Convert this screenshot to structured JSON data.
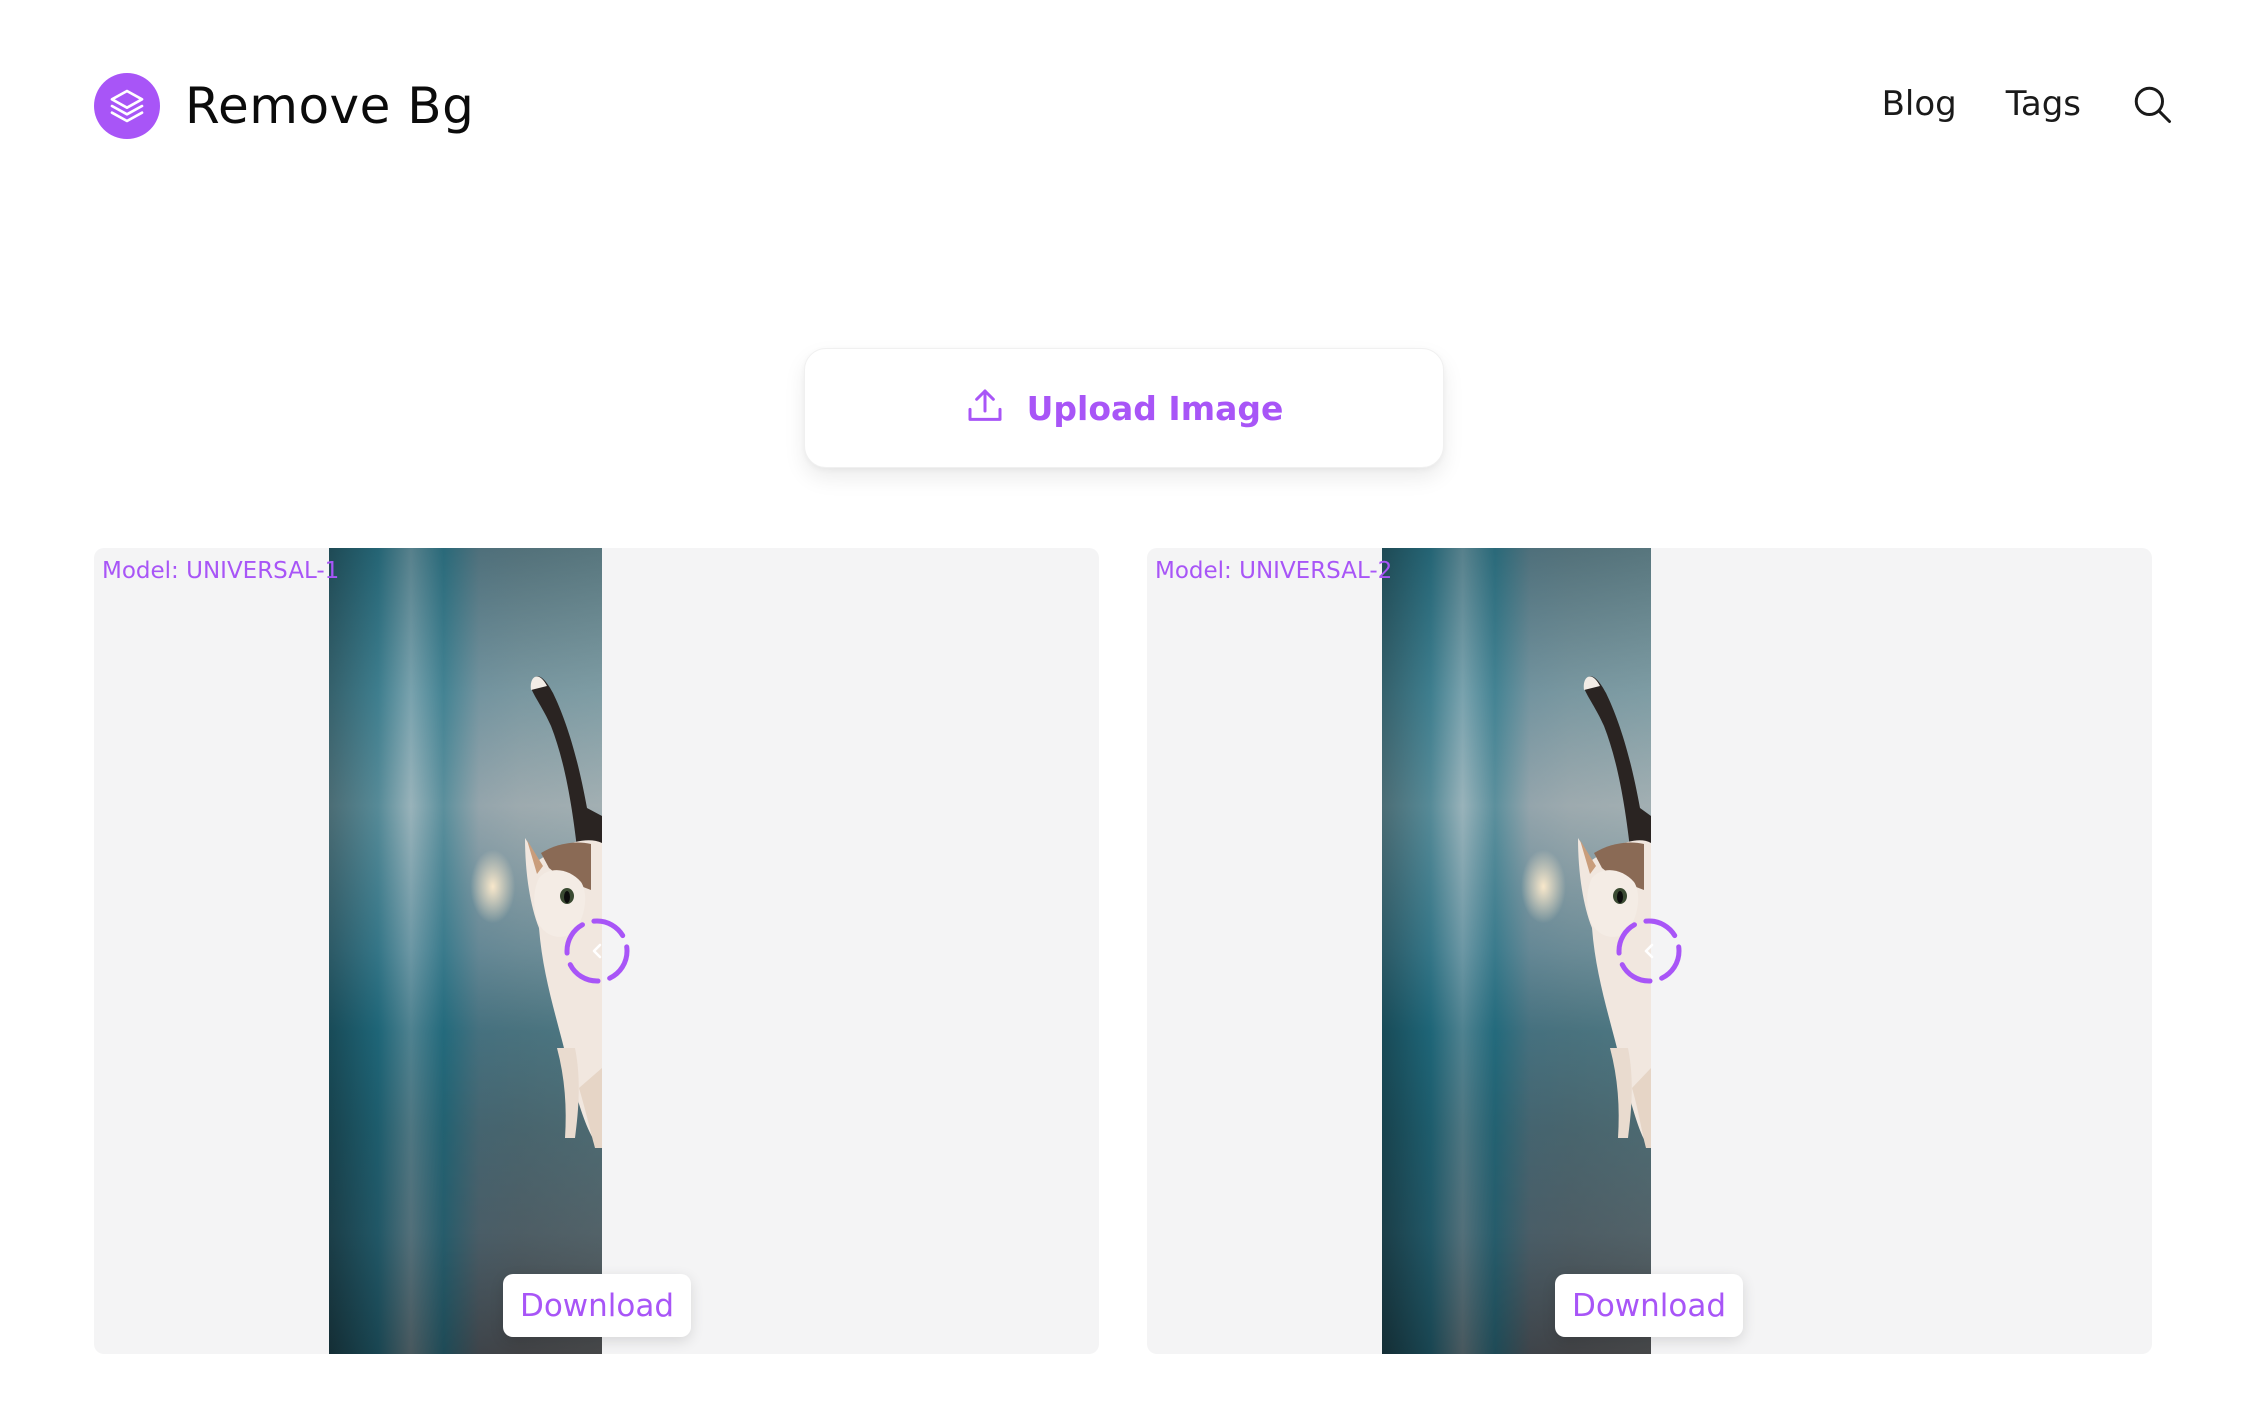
{
  "header": {
    "logo_text": "Remove Bg",
    "nav": [
      {
        "label": "Blog"
      },
      {
        "label": "Tags"
      }
    ]
  },
  "upload": {
    "label": "Upload Image"
  },
  "results": [
    {
      "model_label": "Model: UNIVERSAL-1",
      "download_label": "Download",
      "icon": "chevron-left-icon"
    },
    {
      "model_label": "Model: UNIVERSAL-2",
      "download_label": "Download",
      "icon": "chevron-left-icon"
    }
  ],
  "colors": {
    "accent": "#a855f7",
    "card_background": "#f4f4f5",
    "text": "#111111"
  },
  "icons": {
    "logo": "layers-icon",
    "search": "search-icon",
    "upload": "upload-icon",
    "slider_handle": "chevron-left-icon"
  }
}
